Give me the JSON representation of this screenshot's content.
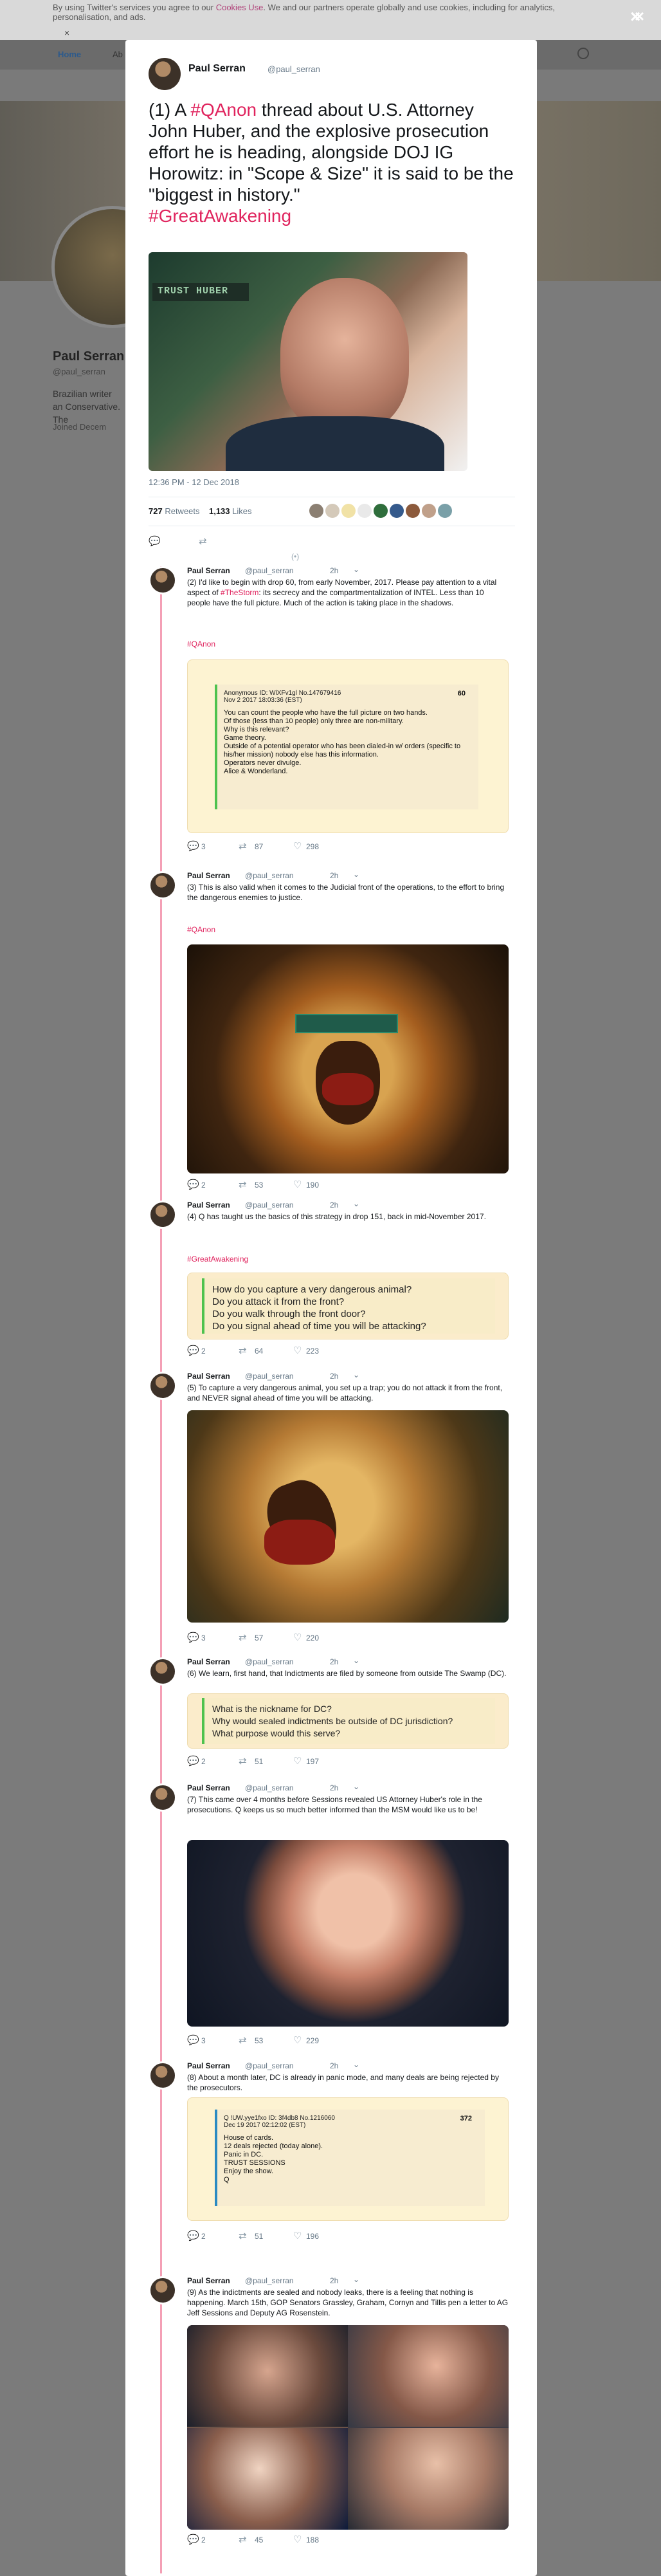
{
  "cookie": {
    "text": "By using Twitter's services you agree to our ",
    "link": "Cookies Use",
    "text2": ". We and our partners operate globally and use cookies, including for analytics, personalisation, and ads.",
    "close_glyph": "×"
  },
  "nav": {
    "home": "Home",
    "home_extra": "Ab",
    "list_hint": "ll ⌄"
  },
  "background_profile": {
    "name": "Paul Serran",
    "handle": "@paul_serran",
    "bio": "Brazilian writer an Conservative. The",
    "joined": "Joined Decem"
  },
  "main_tweet": {
    "name": "Paul Serran",
    "handle": "@paul_serran",
    "text_pre": "(1) A ",
    "hashtag1": "#QAnon",
    "text_post": " thread about U.S. Attorney John Huber, and the explosive prosecution effort he is heading, alongside DOJ IG Horowitz: in \"Scope & Size\" it is said to be the \"biggest in history.\"",
    "hashtag2": "#GreatAwakening",
    "image_text": "TRUST HUBER",
    "timestamp": "12:36 PM - 12 Dec 2018",
    "retweets_count": "727",
    "retweets_label": "Retweets",
    "likes_count": "1,133",
    "likes_label": "Likes",
    "more_replies": "(•)"
  },
  "thread": [
    {
      "name": "Paul Serran",
      "handle": "@paul_serran",
      "time": "2h",
      "text_pre": "(2)  I'd like to begin with drop 60, from early November, 2017. Please pay attention to a vital aspect of ",
      "text_tag": "#TheStorm",
      "text_post": ": its secrecy and the compartmentalization of INTEL. Less than 10 people have the full picture. Much of the action is taking place in the shadows.",
      "hashtag": "#QAnon",
      "post": {
        "header": "Anonymous  ID: WlXFv1gl  No.147679416",
        "date": "Nov 2 2017 18:03:36 (EST)",
        "number": "60",
        "body": "You can count the people who have the full picture on two hands.\nOf those (less than 10 people) only three are non-military.\nWhy is this relevant?\nGame theory.\nOutside of a potential operator who has been dialed-in w/ orders (specific to his/her mission) nobody else has this information.\nOperators never divulge.\nAlice & Wonderland."
      },
      "replies": "3",
      "retweets": "87",
      "likes": "298"
    },
    {
      "name": "Paul Serran",
      "handle": "@paul_serran",
      "time": "2h",
      "text": "(3) This is also valid when it comes to the Judicial front of the operations, to the effort to bring the dangerous enemies to justice.",
      "hashtag": "#QAnon",
      "replies": "2",
      "retweets": "53",
      "likes": "190"
    },
    {
      "name": "Paul Serran",
      "handle": "@paul_serran",
      "time": "2h",
      "text": "(4) Q has taught us the basics of this strategy in drop 151, back in mid-November 2017.",
      "hashtag": "#GreatAwakening",
      "quote": "How do you capture a very dangerous animal?\nDo you attack it from the front?\nDo you walk through the front door?\nDo you signal ahead of time you will be attacking?",
      "replies": "2",
      "retweets": "64",
      "likes": "223"
    },
    {
      "name": "Paul Serran",
      "handle": "@paul_serran",
      "time": "2h",
      "text": "(5) To capture a very dangerous animal, you set up a trap; you do not attack it from the front, and NEVER signal ahead of time you will be attacking.",
      "replies": "3",
      "retweets": "57",
      "likes": "220"
    },
    {
      "name": "Paul Serran",
      "handle": "@paul_serran",
      "time": "2h",
      "text": "(6) We learn, first hand, that Indictments are filed by someone from outside The Swamp (DC).",
      "quote": "What is the nickname for DC?\nWhy would sealed indictments be outside of DC jurisdiction?\nWhat purpose would this serve?",
      "replies": "2",
      "retweets": "51",
      "likes": "197"
    },
    {
      "name": "Paul Serran",
      "handle": "@paul_serran",
      "time": "2h",
      "text": "(7) This came over 4 months before Sessions revealed US Attorney Huber's role in the prosecutions. Q keeps us so much better informed than the MSM would like us to be!",
      "replies": "3",
      "retweets": "53",
      "likes": "229"
    },
    {
      "name": "Paul Serran",
      "handle": "@paul_serran",
      "time": "2h",
      "text": "(8)  About a month later, DC is already in panic mode, and many deals are being rejected by the prosecutors.",
      "post": {
        "header": "Q !UW.yye1fxo  ID: 3f4db8  No.1216060",
        "date": "Dec 19 2017 02:12:02 (EST)",
        "number": "372",
        "body": "House of cards.\n12 deals rejected (today alone).\nPanic in DC.\nTRUST SESSIONS\nEnjoy the show.\nQ"
      },
      "replies": "2",
      "retweets": "51",
      "likes": "196"
    },
    {
      "name": "Paul Serran",
      "handle": "@paul_serran",
      "time": "2h",
      "text": "(9) As the indictments are sealed and nobody leaks, there is a feeling that nothing is happening. March 15th,  GOP Senators Grassley, Graham, Cornyn and Tillis pen a letter to AG Jeff Sessions and Deputy AG Rosenstein.",
      "replies": "2",
      "retweets": "45",
      "likes": "188"
    }
  ],
  "icons": {
    "reply": "reply-icon",
    "retweet": "retweet-icon",
    "like": "heart-icon",
    "chevron": "chevron-down-icon"
  },
  "colors": {
    "hashtag": "#e0245e",
    "thread_line": "#f4a0b6",
    "quote_border": "#4ec24e"
  }
}
